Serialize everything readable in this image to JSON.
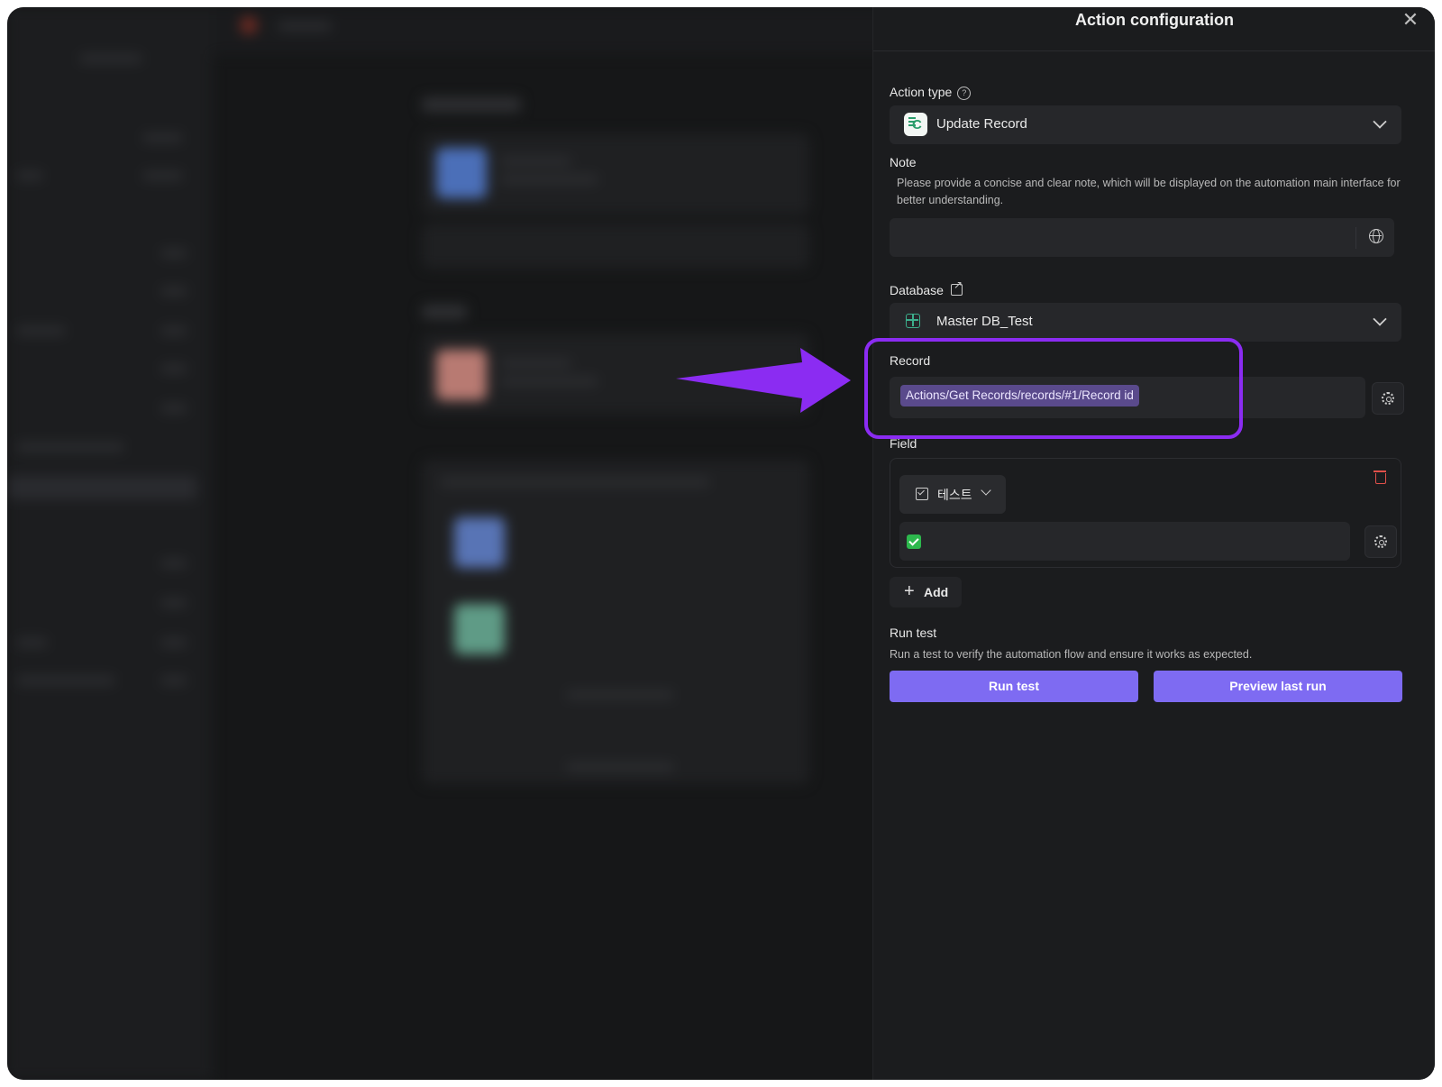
{
  "panel": {
    "title": "Action configuration",
    "close_label": "✕",
    "action_type": {
      "label": "Action type",
      "help_glyph": "?",
      "selected": "Update Record",
      "icon": "update-record-app-icon"
    },
    "note": {
      "label": "Note",
      "hint": "Please provide a concise and clear note, which will be displayed on the automation main interface for better understanding.",
      "value": "",
      "icon": "globe-icon"
    },
    "database": {
      "label": "Database",
      "icon": "external-link-icon",
      "selected": "Master DB_Test",
      "db_icon": "table-icon"
    },
    "record": {
      "label": "Record",
      "token": "Actions/Get Records/records/#1/Record id",
      "icon": "gear-icon"
    },
    "field": {
      "label": "Field",
      "name": "테스트",
      "field_icon": "checkbox-icon",
      "value_checked": true,
      "delete_icon": "trash-icon"
    },
    "add_button": {
      "label": "Add",
      "icon": "plus-icon"
    },
    "run_test": {
      "label": "Run test",
      "hint": "Run a test to verify the automation flow and ensure it works as expected.",
      "run_button": "Run test",
      "preview_button": "Preview last run"
    }
  },
  "colors": {
    "accent": "#7e6bf2",
    "highlight": "#8b2cf2",
    "token_bg": "#5a4a8c",
    "check_green": "#2db84d",
    "danger": "#e0504a"
  }
}
